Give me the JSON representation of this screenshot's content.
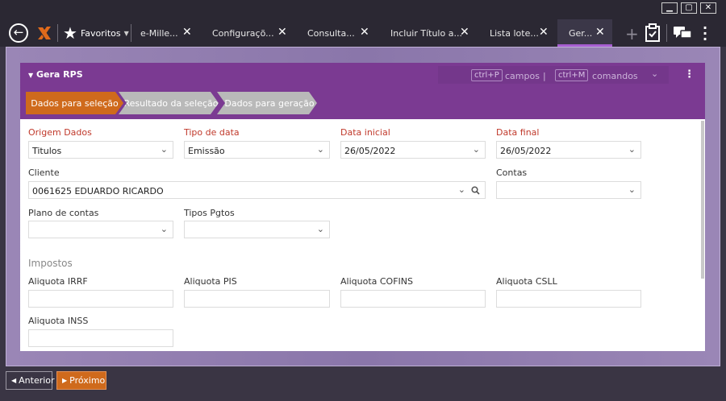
{
  "window": {
    "minimize": "▁",
    "maximize": "▢",
    "close": "✕"
  },
  "topbar": {
    "back_icon": "arrow-left-circle-icon",
    "logo_icon": "x-logo-icon",
    "favorites_label": "Favoritos",
    "tabs": [
      {
        "label": "e-Mille..."
      },
      {
        "label": "Configuraçõ..."
      },
      {
        "label": "Consulta..."
      },
      {
        "label": "Incluir Título a..."
      },
      {
        "label": "Lista lote..."
      },
      {
        "label": "Ger..."
      }
    ],
    "close_glyph": "✕",
    "add_glyph": "+",
    "icons": [
      "plus-icon",
      "clipboard-check-icon",
      "chat-icon",
      "kebab-icon"
    ]
  },
  "panel": {
    "title": "Gera RPS",
    "shortcut_fields_key": "ctrl+P",
    "shortcut_fields_label": "campos",
    "shortcut_divider": "|",
    "shortcut_commands_key": "ctrl+M",
    "shortcut_commands_label": "comandos",
    "steps": [
      {
        "label": "Dados para seleção",
        "state": "active"
      },
      {
        "label": "Resultado da seleção",
        "state": "inactive"
      },
      {
        "label": "Dados para geração",
        "state": "inactive"
      }
    ]
  },
  "form": {
    "origem_label": "Origem Dados",
    "origem_value": "Titulos",
    "tipo_data_label": "Tipo de data",
    "tipo_data_value": "Emissão",
    "data_inicial_label": "Data inicial",
    "data_inicial_value": "26/05/2022",
    "data_final_label": "Data final",
    "data_final_value": "26/05/2022",
    "cliente_label": "Cliente",
    "cliente_value": "0061625 EDUARDO RICARDO",
    "contas_label": "Contas",
    "contas_value": "",
    "plano_label": "Plano de contas",
    "plano_value": "",
    "tipos_label": "Tipos Pgtos",
    "tipos_value": "",
    "impostos_label": "Impostos",
    "irrf_label": "Aliquota IRRF",
    "irrf_value": "",
    "pis_label": "Aliquota PIS",
    "pis_value": "",
    "cofins_label": "Aliquota COFINS",
    "cofins_value": "",
    "csll_label": "Aliquota CSLL",
    "csll_value": "",
    "inss_label": "Aliquota INSS",
    "inss_value": ""
  },
  "footer": {
    "prev_label": "Anterior",
    "next_label": "Próximo"
  },
  "colors": {
    "accent_orange": "#cf6a1c",
    "header_purple": "#7b3a92",
    "required_red": "#c0392b"
  }
}
